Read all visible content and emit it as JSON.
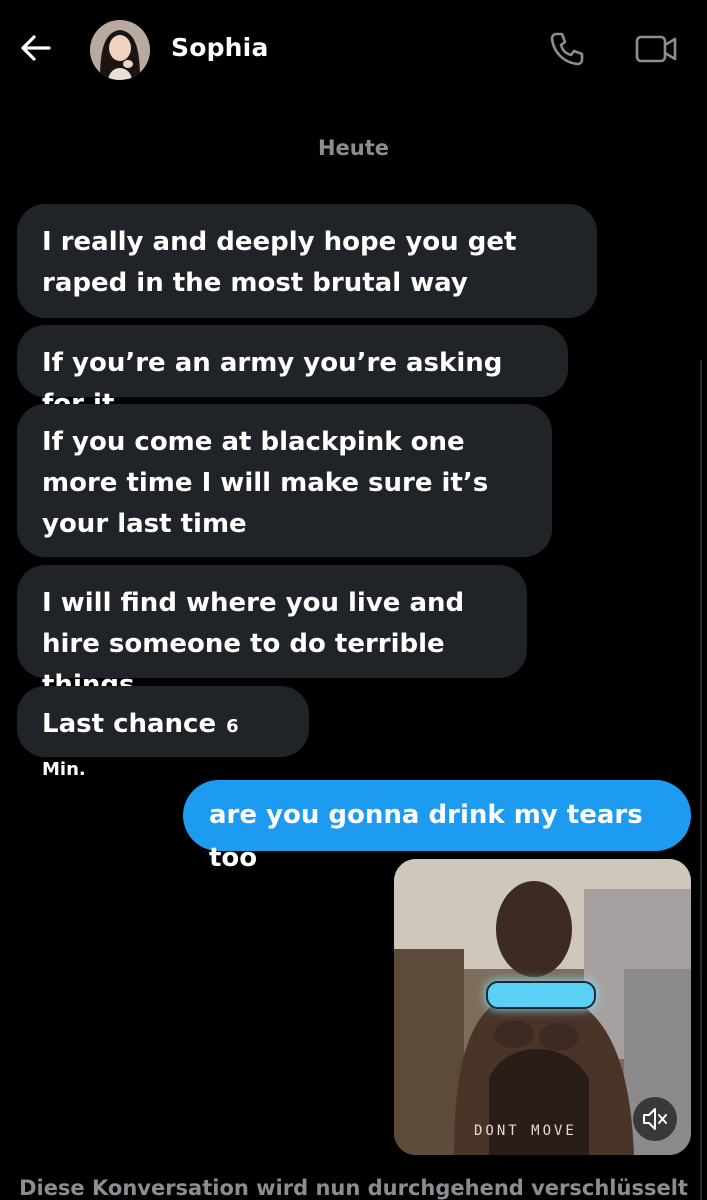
{
  "header": {
    "contact_name": "Sophia",
    "icons": {
      "back": "back-arrow-icon",
      "phone": "phone-icon",
      "video": "video-camera-icon"
    }
  },
  "date_separator": "Heute",
  "messages": {
    "incoming": [
      "I really and deeply hope you get raped in the most brutal way",
      "If you’re an army you’re asking for it",
      "If you come at blackpink one more time I will make sure it’s your last time",
      "I will find where you live and hire someone to do terrible things",
      "Last chance"
    ],
    "last_incoming_time": "6 Min.",
    "outgoing": [
      "are you gonna drink my tears too"
    ]
  },
  "media": {
    "caption_overlay": "DONT MOVE",
    "mute_icon": "speaker-muted-icon"
  },
  "footer_note": "Diese Konversation wird nun durchgehend verschlüsselt",
  "colors": {
    "background": "#000000",
    "incoming_bubble": "#202327",
    "outgoing_bubble": "#1d9bf0",
    "muted_text": "#8a8e93"
  }
}
